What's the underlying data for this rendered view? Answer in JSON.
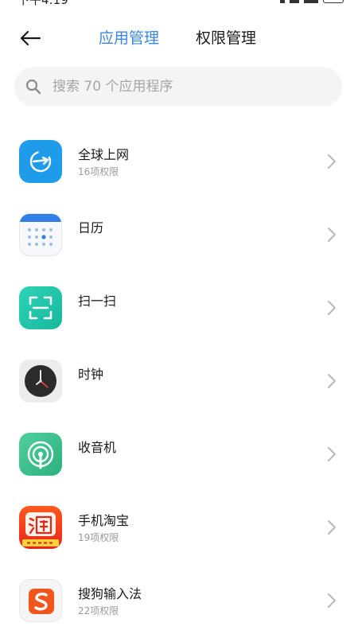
{
  "status": {
    "time": "下午4:19"
  },
  "header": {
    "tabs": [
      {
        "label": "应用管理",
        "active": true
      },
      {
        "label": "权限管理",
        "active": false
      }
    ]
  },
  "search": {
    "placeholder": "搜索 70 个应用程序"
  },
  "apps": [
    {
      "name": "全球上网",
      "permissions": "16项权限",
      "icon": "globe-airplane-icon"
    },
    {
      "name": "日历",
      "permissions": "",
      "icon": "calendar-icon"
    },
    {
      "name": "扫一扫",
      "permissions": "",
      "icon": "scanner-icon"
    },
    {
      "name": "时钟",
      "permissions": "",
      "icon": "clock-icon"
    },
    {
      "name": "收音机",
      "permissions": "",
      "icon": "radio-icon"
    },
    {
      "name": "手机淘宝",
      "permissions": "19项权限",
      "icon": "taobao-icon"
    },
    {
      "name": "搜狗输入法",
      "permissions": "22项权限",
      "icon": "sogou-icon"
    }
  ],
  "colors": {
    "accent": "#3b87e0",
    "secondary_text": "#9a9a9a"
  }
}
